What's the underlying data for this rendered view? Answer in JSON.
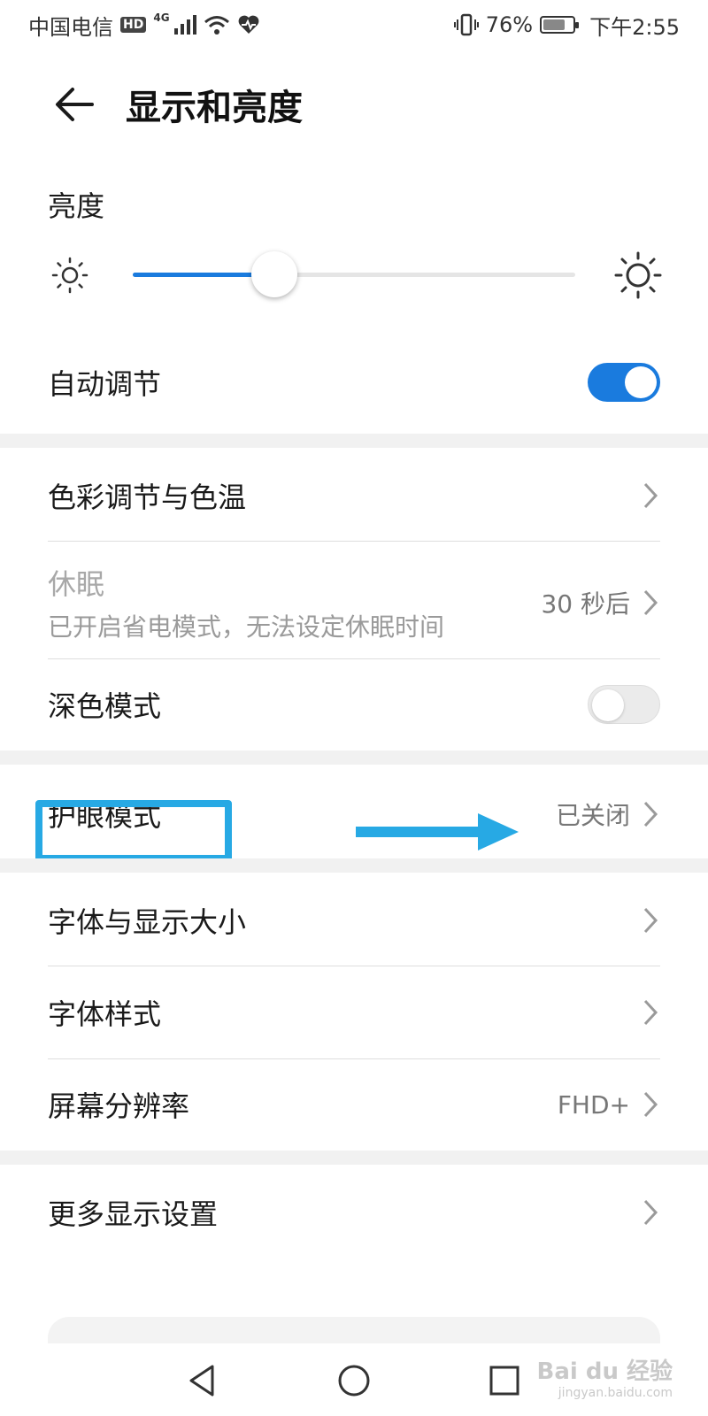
{
  "status_bar": {
    "carrier": "中国电信",
    "hd_badge": "HD",
    "network_label": "4G",
    "battery_percent": "76%",
    "battery_level": 0.76,
    "time": "下午2:55"
  },
  "header": {
    "title": "显示和亮度",
    "back_icon": "arrow-left-icon"
  },
  "brightness": {
    "title": "亮度",
    "level": 0.32,
    "accent_color": "#1a7bde"
  },
  "auto_adjust": {
    "label": "自动调节",
    "enabled": true
  },
  "color_temp": {
    "label": "色彩调节与色温"
  },
  "sleep": {
    "label": "休眠",
    "subtitle": "已开启省电模式，无法设定休眠时间",
    "value": "30 秒后"
  },
  "dark_mode": {
    "label": "深色模式",
    "enabled": false
  },
  "eye_comfort": {
    "label": "护眼模式",
    "value": "已关闭"
  },
  "font_size": {
    "label": "字体与显示大小"
  },
  "font_style": {
    "label": "字体样式"
  },
  "resolution": {
    "label": "屏幕分辨率",
    "value": "FHD+"
  },
  "more_settings": {
    "label": "更多显示设置"
  },
  "annotation": {
    "color": "#27a9e4"
  },
  "watermark": {
    "text": "Bai du 经验",
    "url_text": "jingyan.baidu.com"
  }
}
